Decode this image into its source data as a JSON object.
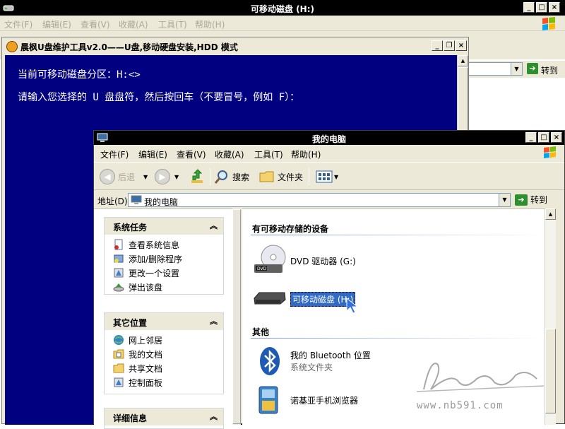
{
  "bg_window": {
    "title": "可移动磁盘 (H:)",
    "menu": [
      "文件(F)",
      "编辑(E)",
      "查看(V)",
      "收藏(A)",
      "工具(T)",
      "帮助(H)"
    ],
    "go_label": "转到"
  },
  "console": {
    "title": "晨枫U盘维护工具v2.0——U盘,移动硬盘安装,HDD 模式",
    "line1": "当前可移动磁盘分区：H:<>",
    "line2": "请输入您选择的 U 盘盘符，然后按回车（不要冒号，例如 F）："
  },
  "mycomputer": {
    "title": "我的电脑",
    "menu": [
      "文件(F)",
      "编辑(E)",
      "查看(V)",
      "收藏(A)",
      "工具(T)",
      "帮助(H)"
    ],
    "toolbar": {
      "back": "后退",
      "search": "搜索",
      "folders": "文件夹"
    },
    "address": {
      "label": "地址(D)",
      "value": "我的电脑",
      "go": "转到"
    },
    "system_tasks": {
      "title": "系统任务",
      "items": [
        "查看系统信息",
        "添加/删除程序",
        "更改一个设置",
        "弹出该盘"
      ]
    },
    "other_places": {
      "title": "其它位置",
      "items": [
        "网上邻居",
        "我的文档",
        "共享文档",
        "控制面板"
      ]
    },
    "details": {
      "title": "详细信息"
    },
    "groups": {
      "removable_title": "有可移动存储的设备",
      "dvd_label": "DVD 驱动器 (G:)",
      "removable_label": "可移动磁盘 (H:)",
      "other_title": "其他",
      "bluetooth_label": "我的 Bluetooth 位置",
      "bluetooth_sub": "系统文件夹",
      "nokia_label": "诺基亚手机浏览器"
    }
  },
  "watermark": {
    "url": "www.nb591.com"
  },
  "colors": {
    "console_bg": "#000080",
    "titlebar": "#000000",
    "selection": "#316ac5",
    "face": "#ece9d8"
  }
}
